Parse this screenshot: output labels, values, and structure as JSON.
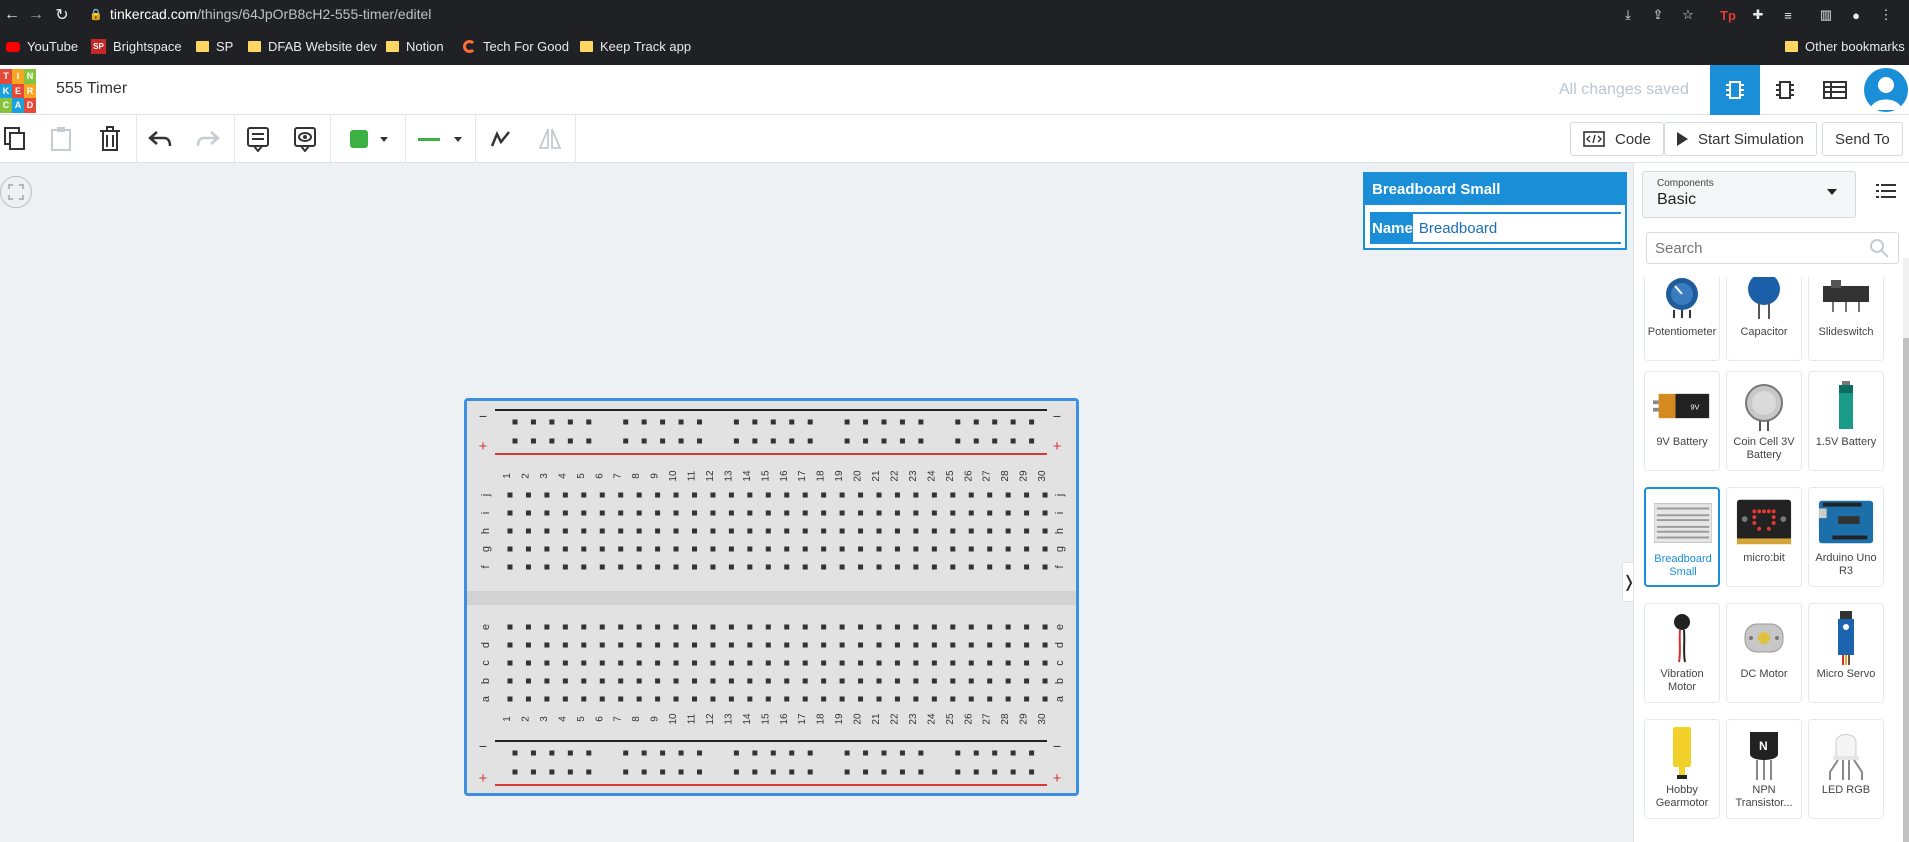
{
  "browser": {
    "url_host": "tinkercad.com",
    "url_path": "/things/64JpOrB8cH2-555-timer/editel"
  },
  "bookmarks": [
    {
      "label": "YouTube",
      "icon": "youtube-icon"
    },
    {
      "label": "Brightspace",
      "icon": "brightspace-icon"
    },
    {
      "label": "SP",
      "icon": "folder-icon"
    },
    {
      "label": "DFAB Website dev",
      "icon": "folder-icon"
    },
    {
      "label": "Notion",
      "icon": "folder-icon"
    },
    {
      "label": "Tech For Good",
      "icon": "tech-icon"
    },
    {
      "label": "Keep Track app",
      "icon": "folder-icon"
    },
    {
      "label": "Other bookmarks",
      "icon": "folder-icon"
    }
  ],
  "app": {
    "logo_letters": [
      "T",
      "I",
      "N",
      "K",
      "E",
      "R",
      "C",
      "A",
      "D"
    ],
    "title": "555 Timer",
    "save_status": "All changes saved"
  },
  "toolbar": {
    "code_label": "Code",
    "start_sim_label": "Start Simulation",
    "send_to_label": "Send To"
  },
  "inspector": {
    "title": "Breadboard Small",
    "name_label": "Name",
    "name_value": "Breadboard"
  },
  "panel": {
    "select_label": "Components",
    "select_value": "Basic",
    "search_placeholder": "Search"
  },
  "components": [
    {
      "label": "Potentiometer"
    },
    {
      "label": "Capacitor"
    },
    {
      "label": "Slideswitch"
    },
    {
      "label": "9V Battery"
    },
    {
      "label": "Coin Cell 3V Battery"
    },
    {
      "label": "1.5V Battery"
    },
    {
      "label": "Breadboard Small"
    },
    {
      "label": "micro:bit"
    },
    {
      "label": "Arduino Uno R3"
    },
    {
      "label": "Vibration Motor"
    },
    {
      "label": "DC Motor"
    },
    {
      "label": "Micro Servo"
    },
    {
      "label": "Hobby Gearmotor"
    },
    {
      "label": "NPN Transistor..."
    },
    {
      "label": "LED RGB"
    }
  ],
  "breadboard": {
    "columns": 30,
    "rows_top": [
      "j",
      "i",
      "h",
      "g",
      "f"
    ],
    "rows_bottom": [
      "e",
      "d",
      "c",
      "b",
      "a"
    ],
    "rail_minus": "−",
    "rail_plus": "+"
  },
  "colors": {
    "accent": "#1a8fd8",
    "chrome": "#202124",
    "rail_red": "#d23a3a"
  }
}
